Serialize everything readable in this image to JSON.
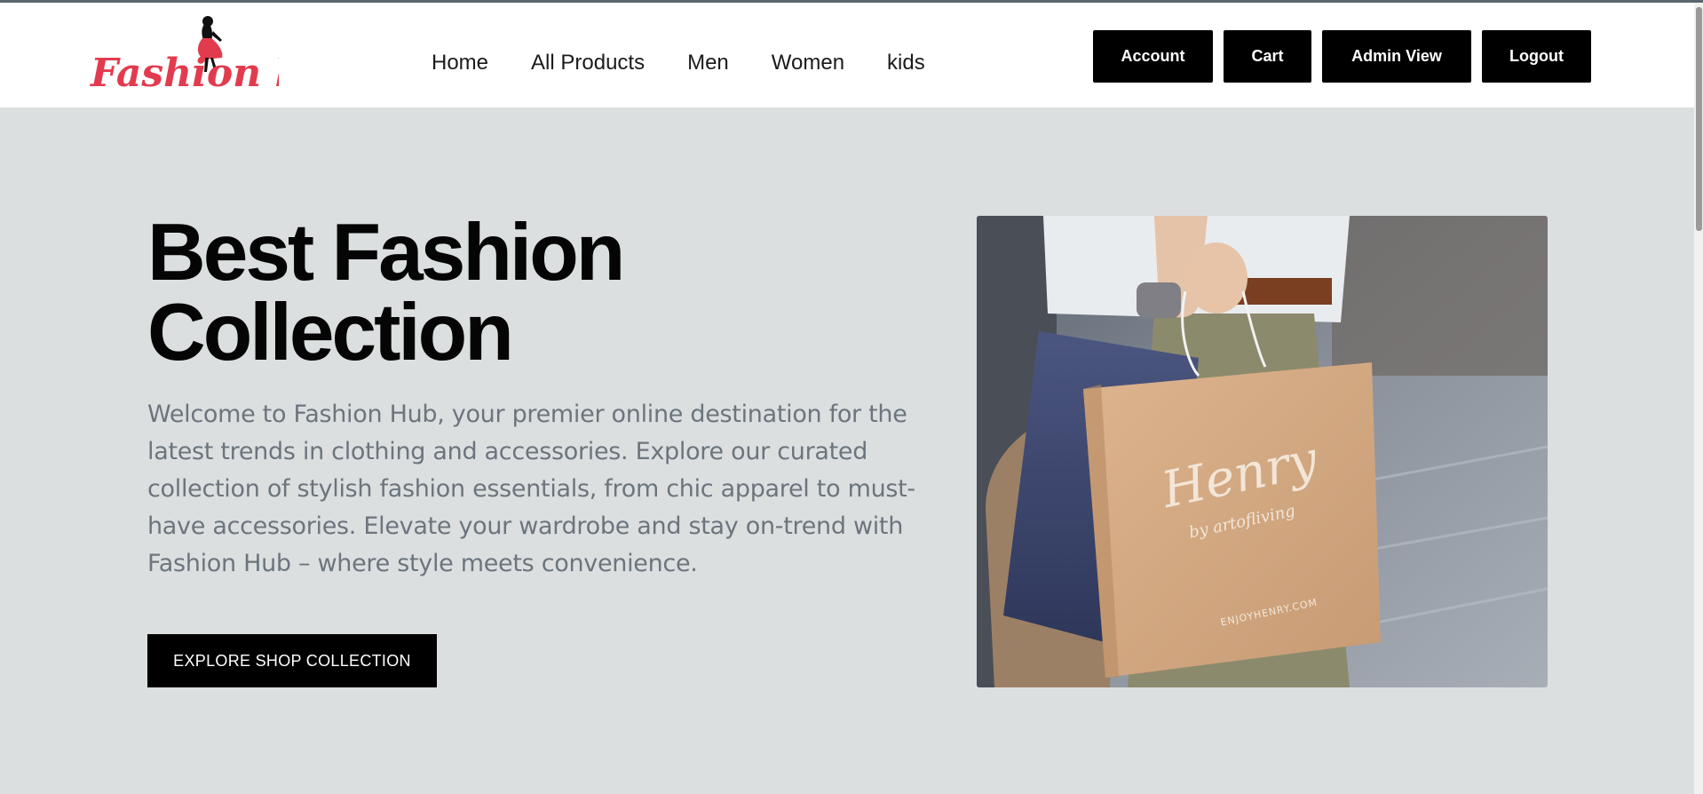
{
  "brand": {
    "name": "Fashion hub"
  },
  "nav": {
    "links": [
      "Home",
      "All Products",
      "Men",
      "Women",
      "kids"
    ],
    "buttons": {
      "account": "Account",
      "cart": "Cart",
      "admin": "Admin View",
      "logout": "Logout"
    }
  },
  "hero": {
    "title_line1": "Best Fashion",
    "title_line2": "Collection",
    "description": "Welcome to Fashion Hub, your premier online destination for the latest trends in clothing and accessories. Explore our curated collection of stylish fashion essentials, from chic apparel to must-have accessories. Elevate your wardrobe and stay on-trend with Fashion Hub – where style meets convenience.",
    "cta_label": "EXPLORE SHOP COLLECTION",
    "image": {
      "bag_brand": "Henry",
      "bag_tagline": "by artofliving",
      "bag_url": "ENJOYHENRY.COM"
    }
  },
  "colors": {
    "brand": "#e23b4e",
    "button_bg": "#000000",
    "page_bg": "#dcdfe0",
    "muted_text": "#6c757d"
  },
  "icons": {
    "logo": "fashion-figure-logo"
  }
}
